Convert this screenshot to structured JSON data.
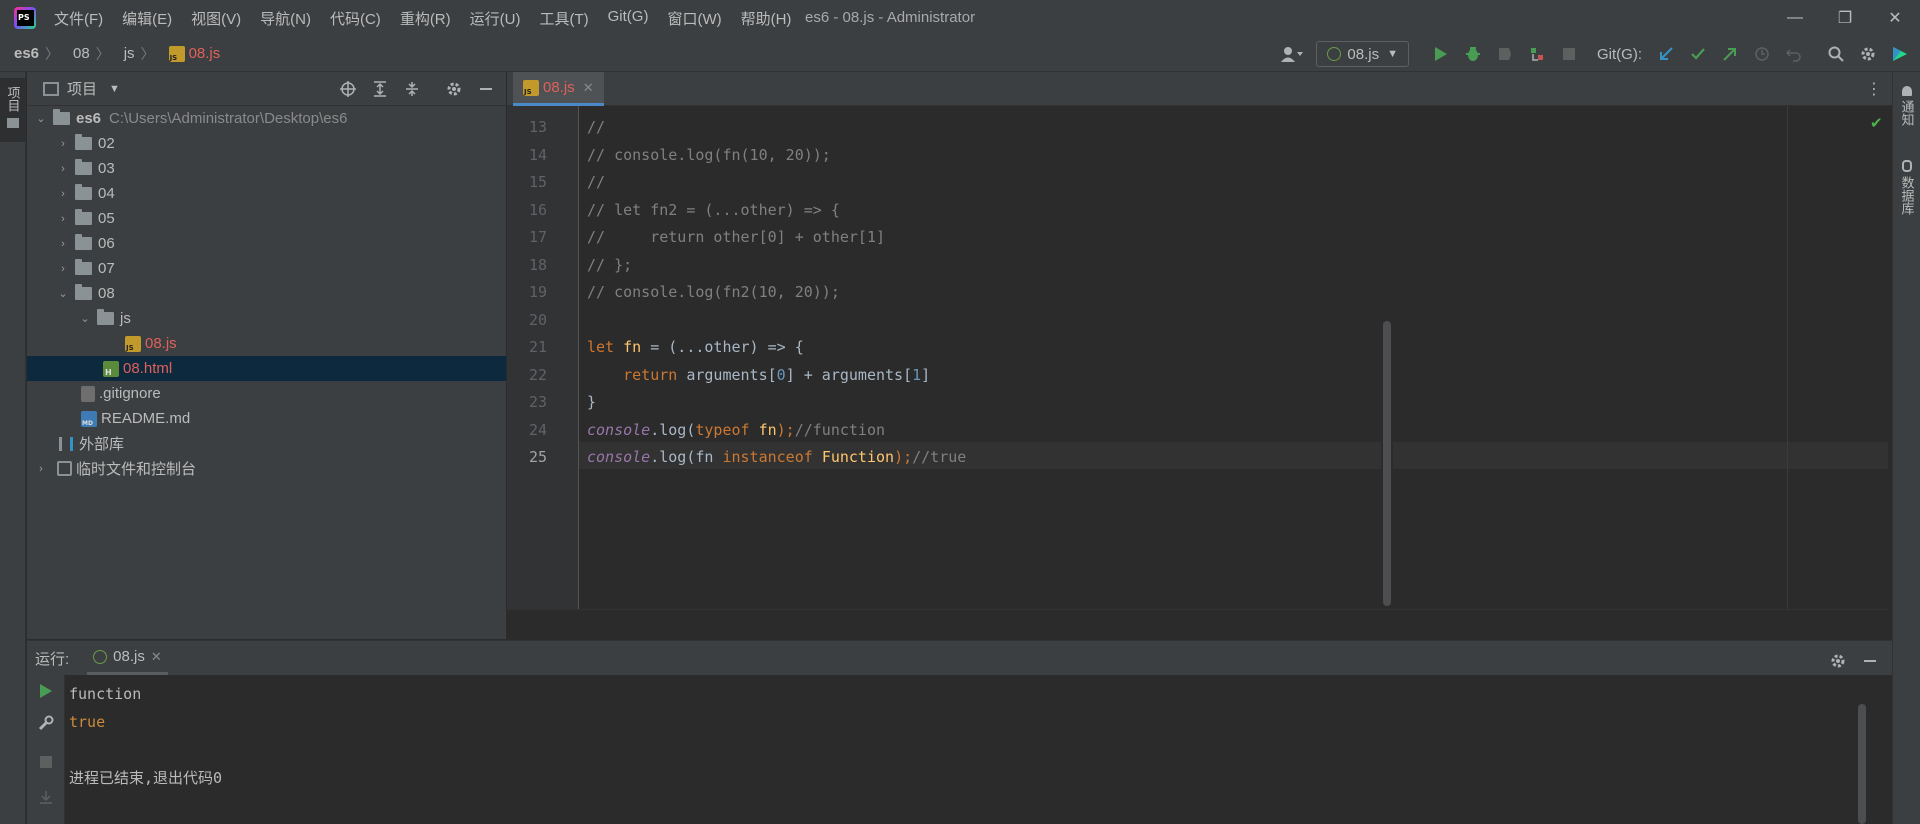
{
  "title_bar": {
    "menus": [
      "文件(F)",
      "编辑(E)",
      "视图(V)",
      "导航(N)",
      "代码(C)",
      "重构(R)",
      "运行(U)",
      "工具(T)",
      "Git(G)",
      "窗口(W)",
      "帮助(H)"
    ],
    "window_title": "es6 - 08.js - Administrator",
    "controls": {
      "minimize": "—",
      "restore": "❐",
      "close": "✕"
    }
  },
  "navbar": {
    "breadcrumbs": [
      "es6",
      "08",
      "js",
      "08.js"
    ],
    "run_config": "08.js",
    "git_label": "Git(G):"
  },
  "left_strip": {
    "project_tab": "项目"
  },
  "project_panel": {
    "header_title": "项目",
    "tree": [
      {
        "label": "es6",
        "hint": "C:\\Users\\Administrator\\Desktop\\es6"
      },
      {
        "label": "02"
      },
      {
        "label": "03"
      },
      {
        "label": "04"
      },
      {
        "label": "05"
      },
      {
        "label": "06"
      },
      {
        "label": "07"
      },
      {
        "label": "08"
      },
      {
        "label": "js"
      },
      {
        "label": "08.js"
      },
      {
        "label": "08.html"
      },
      {
        "label": ".gitignore"
      },
      {
        "label": "README.md"
      },
      {
        "label": "外部库"
      },
      {
        "label": "临时文件和控制台"
      }
    ]
  },
  "editor": {
    "tab_label": "08.js",
    "line_numbers": [
      "13",
      "14",
      "15",
      "16",
      "17",
      "18",
      "19",
      "20",
      "21",
      "22",
      "23",
      "24",
      "25"
    ],
    "current_line": "25",
    "lines": [
      [
        {
          "t": "//",
          "c": "cm"
        }
      ],
      [
        {
          "t": "// console.log(fn(10, 20));",
          "c": "cm"
        }
      ],
      [
        {
          "t": "//",
          "c": "cm"
        }
      ],
      [
        {
          "t": "// let fn2 = (...other) => {",
          "c": "cm"
        }
      ],
      [
        {
          "t": "//     return other[0] + other[1]",
          "c": "cm"
        }
      ],
      [
        {
          "t": "// };",
          "c": "cm"
        }
      ],
      [
        {
          "t": "// console.log(fn2(10, 20));",
          "c": "cm"
        }
      ],
      [],
      [
        {
          "t": "let ",
          "c": "kw"
        },
        {
          "t": "fn",
          "c": "fn-name"
        },
        {
          "t": " = (...other) => {",
          "c": "pl"
        }
      ],
      [
        {
          "t": "    return ",
          "c": "kw"
        },
        {
          "t": "arguments[",
          "c": "pl"
        },
        {
          "t": "0",
          "c": "num"
        },
        {
          "t": "] + arguments[",
          "c": "pl"
        },
        {
          "t": "1",
          "c": "num"
        },
        {
          "t": "]",
          "c": "pl"
        }
      ],
      [
        {
          "t": "}",
          "c": "pl"
        }
      ],
      [
        {
          "t": "console",
          "c": "glob"
        },
        {
          "t": ".log(",
          "c": "pl"
        },
        {
          "t": "typeof ",
          "c": "kw"
        },
        {
          "t": "fn",
          "c": "fn-name"
        },
        {
          "t": ");",
          "c": "kw"
        },
        {
          "t": "//function",
          "c": "cm"
        }
      ],
      [
        {
          "t": "console",
          "c": "glob"
        },
        {
          "t": ".log(fn ",
          "c": "pl"
        },
        {
          "t": "instanceof ",
          "c": "kw"
        },
        {
          "t": "Function",
          "c": "fn-name"
        },
        {
          "t": ");",
          "c": "kw"
        },
        {
          "t": "//true",
          "c": "cm"
        }
      ]
    ]
  },
  "right_strip": {
    "notifications": "通知",
    "database": "数据库"
  },
  "run_panel": {
    "label": "运行:",
    "tab_label": "08.js",
    "output": [
      {
        "text": "function",
        "color": "#bbbbbb"
      },
      {
        "text": "true",
        "color": "#cc8a3a"
      },
      {
        "text": "",
        "color": "#bbbbbb"
      },
      {
        "text": "进程已结束,退出代码0",
        "color": "#bbbbbb"
      }
    ]
  },
  "colors": {
    "accent": "#4a88c7",
    "selection": "#0d293e",
    "run_green": "#499c54",
    "orange_file": "#e0605a"
  }
}
